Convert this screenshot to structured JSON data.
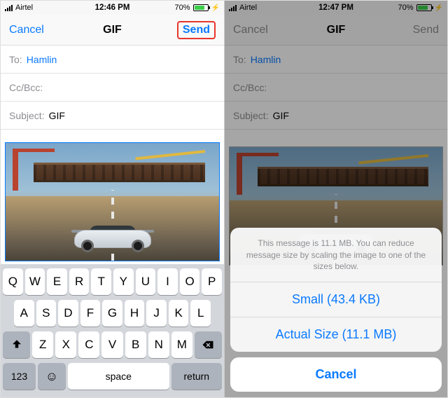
{
  "left": {
    "status": {
      "carrier": "Airtel",
      "time": "12:46 PM",
      "battery": "70%"
    },
    "nav": {
      "cancel": "Cancel",
      "title": "GIF",
      "send": "Send"
    },
    "fields": {
      "to_label": "To:",
      "to_value": "Hamlin",
      "ccbcc_label": "Cc/Bcc:",
      "subject_label": "Subject:",
      "subject_value": "GIF"
    },
    "keyboard": {
      "row1": [
        "Q",
        "W",
        "E",
        "R",
        "T",
        "Y",
        "U",
        "I",
        "O",
        "P"
      ],
      "row2": [
        "A",
        "S",
        "D",
        "F",
        "G",
        "H",
        "J",
        "K",
        "L"
      ],
      "row3": [
        "Z",
        "X",
        "C",
        "V",
        "B",
        "N",
        "M"
      ],
      "num": "123",
      "space": "space",
      "return": "return"
    }
  },
  "right": {
    "status": {
      "carrier": "Airtel",
      "time": "12:47 PM",
      "battery": "70%"
    },
    "nav": {
      "cancel": "Cancel",
      "title": "GIF",
      "send": "Send"
    },
    "fields": {
      "to_label": "To:",
      "to_value": "Hamlin",
      "ccbcc_label": "Cc/Bcc:",
      "subject_label": "Subject:",
      "subject_value": "GIF"
    },
    "sheet": {
      "message": "This message is 11.1 MB. You can reduce message size by scaling the image to one of the sizes below.",
      "option_small": "Small (43.4 KB)",
      "option_actual": "Actual Size (11.1 MB)",
      "cancel": "Cancel"
    }
  }
}
